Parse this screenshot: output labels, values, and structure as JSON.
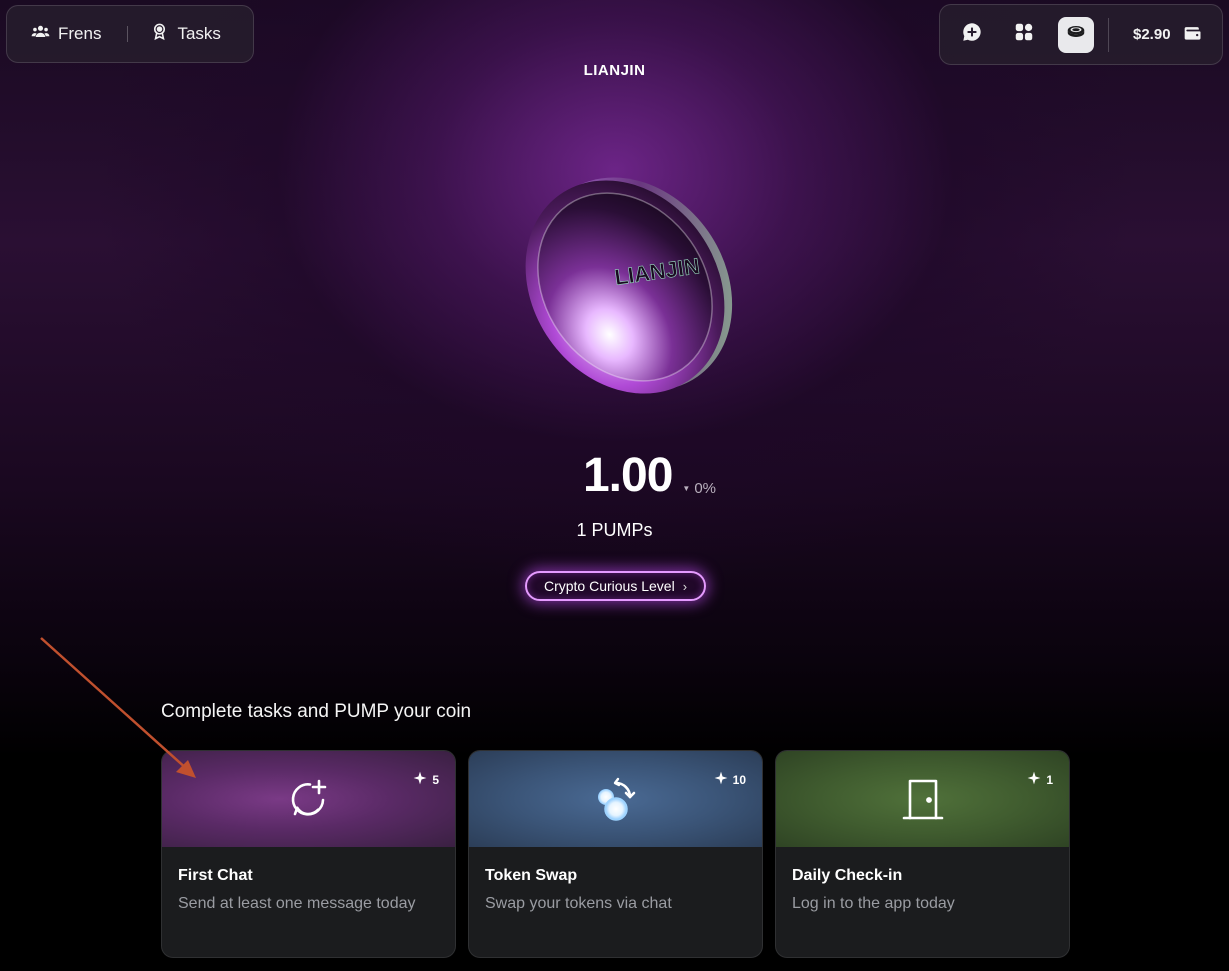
{
  "nav": {
    "frens_label": "Frens",
    "tasks_label": "Tasks"
  },
  "toolbar": {
    "balance": "$2.90",
    "icons": [
      "chat-plus-icon",
      "apps-grid-icon",
      "coin-stack-icon",
      "wallet-icon"
    ]
  },
  "coin": {
    "name": "LIANJIN",
    "price": "1.00",
    "change": "0%",
    "change_direction": "down",
    "pumps": "1 PUMPs",
    "level_label": "Crypto Curious Level"
  },
  "tasks": {
    "heading": "Complete tasks and PUMP your coin",
    "items": [
      {
        "title": "First Chat",
        "description": "Send at least one message today",
        "reward": "5",
        "icon": "chat-plus-icon"
      },
      {
        "title": "Token Swap",
        "description": "Swap your tokens via chat",
        "reward": "10",
        "icon": "swap-coins-icon"
      },
      {
        "title": "Daily Check-in",
        "description": "Log in to the app today",
        "reward": "1",
        "icon": "door-icon"
      }
    ]
  },
  "colors": {
    "accent_glow": "#e59bff",
    "card_purple": "#5a2a66",
    "card_blue": "#3b5578",
    "card_green": "#405c2f",
    "annotation_arrow": "#c0502e"
  }
}
